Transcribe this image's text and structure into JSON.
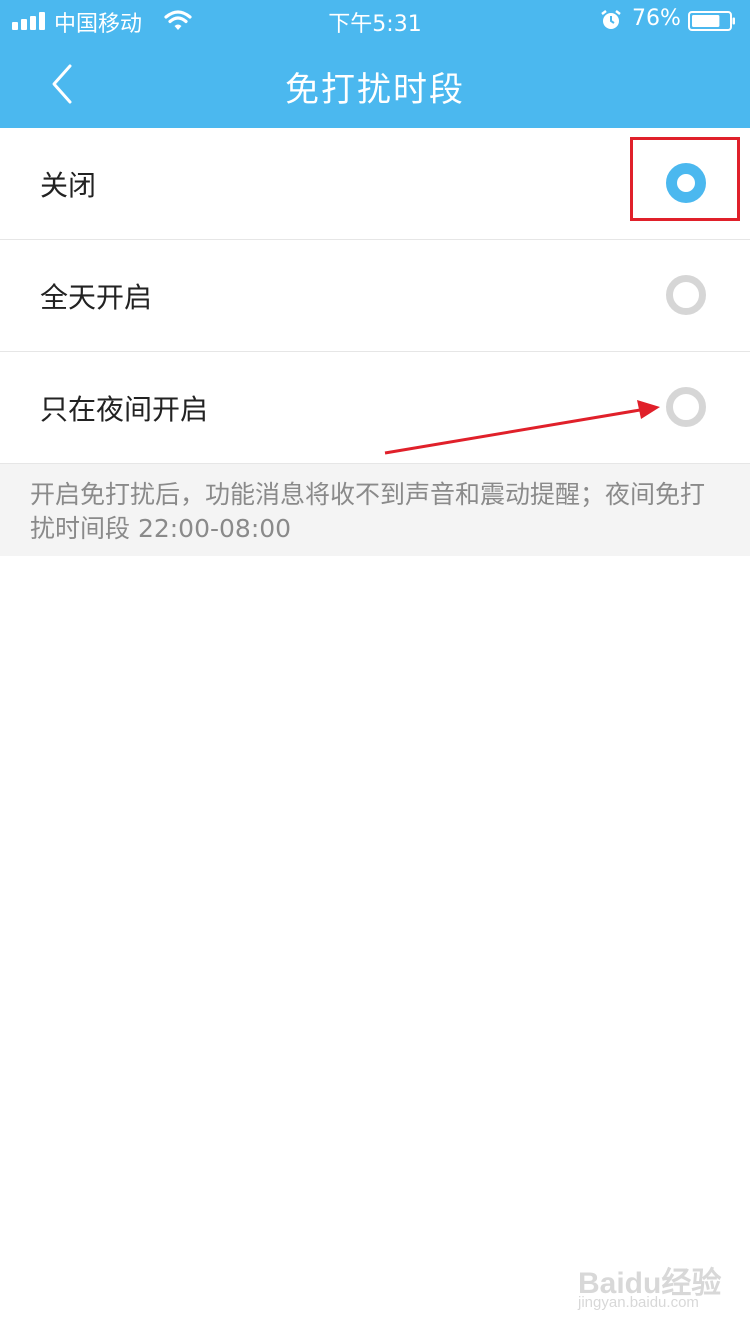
{
  "status_bar": {
    "carrier": "中国移动",
    "time": "下午5:31",
    "battery_percent": "76%",
    "battery_level": 0.76,
    "icons": [
      "signal-icon",
      "wifi-icon",
      "alarm-icon",
      "battery-icon"
    ]
  },
  "nav": {
    "title": "免打扰时段",
    "back_icon": "chevron-left-icon"
  },
  "options": [
    {
      "label": "关闭",
      "selected": true
    },
    {
      "label": "全天开启",
      "selected": false
    },
    {
      "label": "只在夜间开启",
      "selected": false
    }
  ],
  "footnote": "开启免打扰后，功能消息将收不到声音和震动提醒；夜间免打扰时间段 22:00-08:00",
  "watermark": {
    "brand": "Baidu经验",
    "url": "jingyan.baidu.com"
  },
  "colors": {
    "header": "#4bb8ef",
    "radio_selected": "#4bb8ef",
    "radio_unselected": "#d6d6d6",
    "annotation": "#e0202a"
  }
}
